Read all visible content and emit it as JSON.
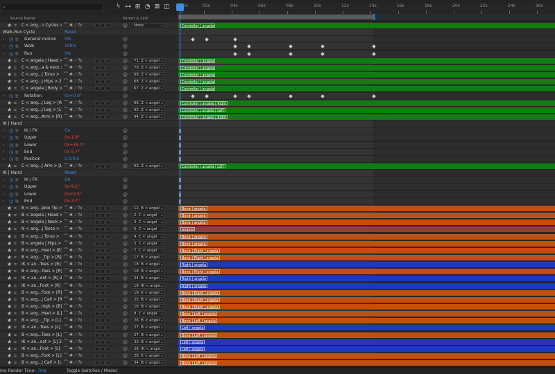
{
  "header": {
    "source_name": "Source Name",
    "parent_link": "Parent & Link"
  },
  "ruler": {
    "labels": [
      "00s",
      "02s",
      "04s",
      "06s",
      "08s",
      "10s",
      "12s",
      "14s",
      "16s",
      "18s",
      "20s",
      "22s",
      "24s",
      "26s"
    ]
  },
  "footer": {
    "render_time_label": "me Render Time:",
    "render_time_value": "7ms",
    "toggle_label": "Toggle Switches / Modes"
  },
  "rows": [
    {
      "kind": "layer",
      "name": "C < ang...n Cycles >",
      "parent": "None",
      "bar": "g",
      "bar_label": "Controller | angela"
    },
    {
      "kind": "group",
      "name": "Walk-Run Cycle",
      "value": "Reset"
    },
    {
      "kind": "prop",
      "name": "General motion",
      "value": "0%"
    },
    {
      "kind": "prop",
      "name": "Walk",
      "value": "100%"
    },
    {
      "kind": "prop",
      "name": "Run",
      "value": "0%"
    },
    {
      "kind": "layer",
      "name": "C < angela | Head >",
      "parent": "71. Z < angel",
      "bar": "g",
      "bar_label": "Controller | angela"
    },
    {
      "kind": "layer",
      "name": "C < ang...a & neck >",
      "parent": "70. Z < angel",
      "bar": "g",
      "bar_label": "Controller | angela"
    },
    {
      "kind": "layer",
      "name": "C < ang...| Torso >",
      "parent": "69. Z < angel",
      "bar": "g",
      "bar_label": "Controller | angela"
    },
    {
      "kind": "layer",
      "name": "C < ang...| Hips > 2",
      "parent": "68. Z < angel",
      "bar": "g",
      "bar_label": "Controller | angela"
    },
    {
      "kind": "layer",
      "name": "C < angela | Body >",
      "parent": "67. Z < angel",
      "bar": "g",
      "bar_label": "Controller | angela"
    },
    {
      "kind": "prop",
      "name": "Rotation",
      "value": "0x+0.0°"
    },
    {
      "kind": "layer",
      "name": "C < ang...| Leg > [R]",
      "parent": "66. Z < angel",
      "bar": "g",
      "bar_label": "Controller | angela | Right"
    },
    {
      "kind": "layer",
      "name": "C < ang...| Leg > [L]",
      "parent": "65. Z < angel",
      "bar": "g",
      "bar_label": "Controller | angela | Left"
    },
    {
      "kind": "layer",
      "name": "C < ang...Arm > [R]",
      "parent": "64. Z < angel",
      "bar": "g",
      "bar_label": "Controller | angela | Right"
    },
    {
      "kind": "group",
      "name": "IK | Hand",
      "value": ""
    },
    {
      "kind": "prop",
      "name": "IK / FK",
      "value": "On"
    },
    {
      "kind": "prop",
      "name": "Upper",
      "value": "0x-1.8°",
      "red": true
    },
    {
      "kind": "prop",
      "name": "Lower",
      "value": "0x+15.7°",
      "red": true
    },
    {
      "kind": "prop",
      "name": "End",
      "value": "0x-5.7°",
      "red": true
    },
    {
      "kind": "prop",
      "name": "Position",
      "value": "0.0,0.0"
    },
    {
      "kind": "layer",
      "name": "C < ang...| Arm > [L]",
      "parent": "63. Z < angel",
      "bar": "g",
      "bar_label": "Controller | angela | Left"
    },
    {
      "kind": "group",
      "name": "IK | Hand",
      "value": "Reset"
    },
    {
      "kind": "prop",
      "name": "IK / FK",
      "value": "On"
    },
    {
      "kind": "prop",
      "name": "Upper",
      "value": "0x-9.2°",
      "red": true
    },
    {
      "kind": "prop",
      "name": "Lower",
      "value": "0x+9.5°",
      "red": true
    },
    {
      "kind": "prop",
      "name": "End",
      "value": "0x-3.7°",
      "red": true
    },
    {
      "kind": "layer",
      "name": "B < ang...pine Tip >",
      "parent": "12. B < angel",
      "bar": "o",
      "bar_label": "Bone | angela"
    },
    {
      "kind": "layer",
      "name": "B < angela | Head >",
      "parent": "2. C < angel",
      "bar": "o",
      "bar_label": "Bone | angela"
    },
    {
      "kind": "layer",
      "name": "B < angela | Neck >",
      "parent": "3. C < angel",
      "bar": "o",
      "bar_label": "Bone | angela"
    },
    {
      "kind": "layer",
      "name": "N < ang...| Torso >",
      "parent": "5. C < angel",
      "bar": "p",
      "bar_label": "angela"
    },
    {
      "kind": "layer",
      "name": "B < ang...| Torso >",
      "parent": "4. C < angel",
      "bar": "o",
      "bar_label": "Bone | angela"
    },
    {
      "kind": "layer",
      "name": "B < angela | Hips >",
      "parent": "5. C < angel",
      "bar": "o",
      "bar_label": "Bone | angela"
    },
    {
      "kind": "layer",
      "name": "B < ang...Heel > [R]",
      "parent": "7. C < angel",
      "bar": "o",
      "bar_label": "Bone | Right | angela"
    },
    {
      "kind": "layer",
      "name": "B < ang..._Tip > [R]",
      "parent": "17. B < angel",
      "bar": "o",
      "bar_label": "Bone | Right | angela"
    },
    {
      "kind": "layer",
      "name": "IK < an...Toes > [R]",
      "parent": "18. B < angel",
      "bar": "b",
      "bar_label": "Right | angela"
    },
    {
      "kind": "layer",
      "name": "B < ang...Toes > [R]",
      "parent": "18. B < angel",
      "bar": "o",
      "bar_label": "Bone | Right | angela"
    },
    {
      "kind": "layer",
      "name": "IK < an...oot > [R] 2",
      "parent": "24. B < angel",
      "bar": "b",
      "bar_label": "Right | angela"
    },
    {
      "kind": "layer",
      "name": "IK < an...Foot > [R]",
      "parent": "19. IK < angel",
      "bar": "b",
      "bar_label": "Right | angela"
    },
    {
      "kind": "layer",
      "name": "B < ang...Foot > [R]",
      "parent": "19. K < angel",
      "bar": "o",
      "bar_label": "Bone | Right | angela"
    },
    {
      "kind": "layer",
      "name": "B < ang...| Calf > [R]",
      "parent": "25. B < angel",
      "bar": "o",
      "bar_label": "Bone | Right | angela"
    },
    {
      "kind": "layer",
      "name": "B < ang...high > [R]",
      "parent": "16. B < angel",
      "bar": "o",
      "bar_label": "Bone | Right | angela"
    },
    {
      "kind": "layer",
      "name": "B < ang...Heel > [L]",
      "parent": "8. C < angel",
      "bar": "o",
      "bar_label": "Bone | Left | angela"
    },
    {
      "kind": "layer",
      "name": "B < ang..._Tip > [L]",
      "parent": "26. B < angel",
      "bar": "o",
      "bar_label": "Bone | Left | angela"
    },
    {
      "kind": "layer",
      "name": "IK < an...Toes > [L]",
      "parent": "27. B < angel",
      "bar": "b",
      "bar_label": "Left | angela"
    },
    {
      "kind": "layer",
      "name": "B < ang...Toes > [L]",
      "parent": "27. B < angel",
      "bar": "o",
      "bar_label": "Bone | Left | angela"
    },
    {
      "kind": "layer",
      "name": "IK < an...oot > [L] 2",
      "parent": "33. B < angel",
      "bar": "b",
      "bar_label": "Left | angela"
    },
    {
      "kind": "layer",
      "name": "IK < an...Foot > [L]",
      "parent": "28. IK < angel",
      "bar": "b",
      "bar_label": "Left | angela"
    },
    {
      "kind": "layer",
      "name": "B < ang...Foot > [L]",
      "parent": "28. K < angel",
      "bar": "o",
      "bar_label": "Bone | Left | angela"
    },
    {
      "kind": "layer",
      "name": "B < ang...| Calf > [L]",
      "parent": "34. B < angel",
      "bar": "o",
      "bar_label": "Bone | Left | angela"
    }
  ]
}
